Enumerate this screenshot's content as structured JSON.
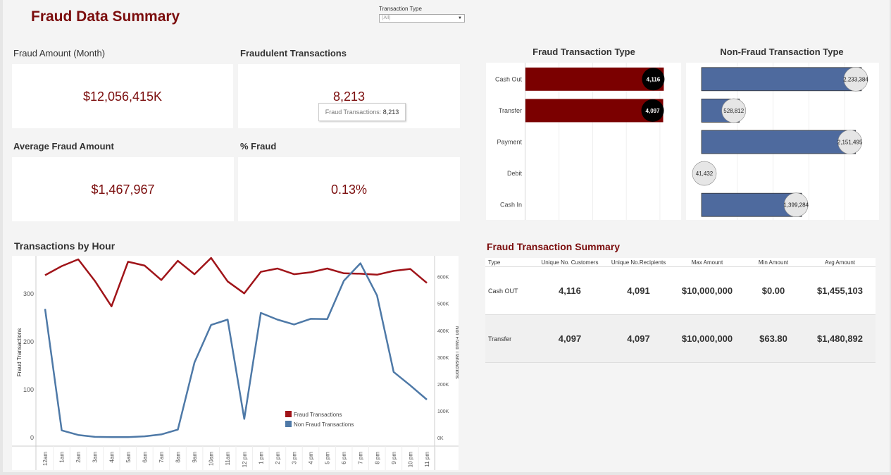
{
  "header": {
    "title": "Fraud Data Summary",
    "filter_label": "Transaction Type",
    "filter_value": "(All)"
  },
  "kpis": {
    "fraud_amount": {
      "label": "Fraud Amount (Month)",
      "value": "$12,056,415K"
    },
    "fraud_transactions": {
      "label": "Fraudulent Transactions",
      "value": "8,213"
    },
    "avg_fraud_amount": {
      "label": "Average Fraud Amount",
      "value": "$1,467,967"
    },
    "pct_fraud": {
      "label": "% Fraud",
      "value": "0.13%"
    }
  },
  "tooltip": {
    "label": "Fraud Transactions:",
    "value": "8,213"
  },
  "colors": {
    "fraud": "#7b0000",
    "nonfraud": "#4e6a9e",
    "line_fraud": "#a01419",
    "line_nonfraud": "#4e79a7",
    "title": "#7b0d0d"
  },
  "chart_data": [
    {
      "type": "bar",
      "title": "Fraud Transaction Type",
      "categories": [
        "Cash Out",
        "Transfer",
        "Payment",
        "Debit",
        "Cash In"
      ],
      "values": [
        4116,
        4097,
        0,
        0,
        0
      ],
      "value_labels": [
        "4,116",
        "4,097",
        "",
        "",
        ""
      ],
      "orientation": "horizontal"
    },
    {
      "type": "bar",
      "title": "Non-Fraud Transaction Type",
      "categories": [
        "Cash Out",
        "Transfer",
        "Payment",
        "Debit",
        "Cash In"
      ],
      "values": [
        2233384,
        528812,
        2151495,
        41432,
        1399284
      ],
      "value_labels": [
        "2,233,384",
        "528,812",
        "2,151,495",
        "41,432",
        "1,399,284"
      ],
      "orientation": "horizontal"
    },
    {
      "type": "line",
      "title": "Transactions by Hour",
      "x": [
        "12am",
        "1am",
        "2am",
        "3am",
        "4am",
        "5am",
        "6am",
        "7am",
        "8am",
        "9am",
        "10am",
        "11am",
        "12 pm",
        "1 pm",
        "2 pm",
        "3 pm",
        "4 pm",
        "5 pm",
        "6 pm",
        "7 pm",
        "8 pm",
        "9 pm",
        "10 pm",
        "11 pm"
      ],
      "ylabel": "Fraud Transactions",
      "y2label": "Non Fraud Transactions",
      "ylim": [
        0,
        375
      ],
      "y_ticks": [
        "0",
        "100",
        "200",
        "300"
      ],
      "y2lim": [
        0,
        670000
      ],
      "y2_ticks": [
        "0K",
        "100K",
        "200K",
        "300K",
        "400K",
        "500K",
        "600K"
      ],
      "series": [
        {
          "name": "Fraud Transactions",
          "axis": "left",
          "values": [
            339,
            358,
            372,
            327,
            274,
            367,
            359,
            329,
            369,
            341,
            375,
            326,
            301,
            346,
            353,
            341,
            345,
            353,
            343,
            342,
            340,
            348,
            352,
            323
          ]
        },
        {
          "name": "Non Fraud Transactions",
          "axis": "right",
          "values": [
            480000,
            27000,
            10000,
            3000,
            2000,
            2000,
            5000,
            12000,
            30000,
            280000,
            420000,
            440000,
            70000,
            465000,
            440000,
            422000,
            443000,
            442000,
            585000,
            650000,
            530000,
            245000,
            195000,
            142000
          ]
        }
      ],
      "legend": "bottom-right"
    }
  ],
  "summary": {
    "title": "Fraud Transaction Summary",
    "columns": [
      "Type",
      "Unique No. Customers",
      "Unique No.Recipients",
      "Max Amount",
      "Min Amount",
      "Avg Amount"
    ],
    "rows": [
      [
        "Cash OUT",
        "4,116",
        "4,091",
        "$10,000,000",
        "$0.00",
        "$1,455,103"
      ],
      [
        "Transfer",
        "4,097",
        "4,097",
        "$10,000,000",
        "$63.80",
        "$1,480,892"
      ]
    ]
  }
}
